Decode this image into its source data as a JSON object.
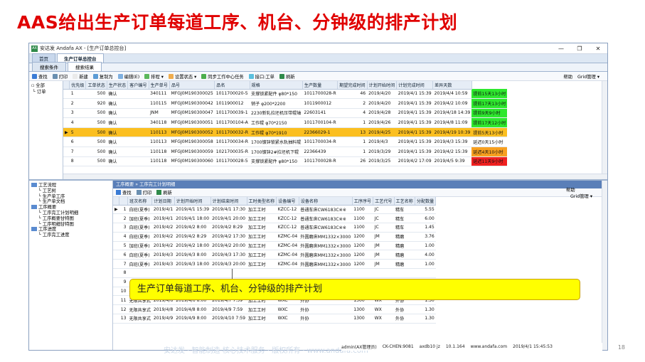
{
  "slide": {
    "title": "AAS给出生产订单每道工序、机台、分钟级的排产计划",
    "page_number": "18",
    "footer_text": "安达发 · 智能制造 核心技术服务 · 版权所有 · www.andafa.com",
    "callout": "生产订单每道工序、机台、分钟级的排产计划"
  },
  "window": {
    "title": "安达发 Andafa AX - [生产订单总控台]",
    "doc_tabs": [
      "首页",
      "生产订单总控台"
    ],
    "sub_tabs": [
      "搜索条件",
      "搜索结果"
    ]
  },
  "toolbar": {
    "items": [
      "查找",
      "打印",
      "新建",
      "复制为",
      "编辑(E)",
      "排程 ▾",
      "设置状态 ▾",
      "同步工作中心任务",
      "接口:工单",
      "刷新"
    ],
    "help": "帮助",
    "grid_mgmt": "Grid管理 ▾"
  },
  "left_tree": [
    "全部",
    "订单"
  ],
  "orders": {
    "columns": [
      "",
      "优先级",
      "工单状态",
      "生产状态",
      "客户编号",
      "生产单号",
      "品号",
      "品名",
      "规格",
      "生产数量",
      "期望完成时间",
      "计划开始时间",
      "计划完成时间",
      "差异天数"
    ],
    "rows": [
      {
        "idx": "1",
        "pri": "500",
        "status": "确认",
        "pstatus": "",
        "cust": "340111",
        "order": "MFGJ0M190300025",
        "item": "1011700020-5",
        "name": "支撑锁紧配件 φ80*150",
        "spec": "1011700028-R",
        "qty": "46",
        "due": "2019/4/20",
        "start": "2019/4/1 15:39",
        "finish": "2019/4/4 10:59",
        "diff": "提前15天13小时",
        "dclass": "st-g"
      },
      {
        "idx": "2",
        "pri": "920",
        "status": "确认",
        "pstatus": "",
        "cust": "110115",
        "order": "MFGJ0M190300042",
        "item": "1011900012",
        "name": "销子 φ200*2200",
        "spec": "1011900012",
        "qty": "2",
        "due": "2019/4/20",
        "start": "2019/4/1 15:39",
        "finish": "2019/4/2 10:09",
        "diff": "提前17天13小时",
        "dclass": "st-g"
      },
      {
        "idx": "3",
        "pri": "500",
        "status": "确认",
        "pstatus": "",
        "cust": "JNM",
        "order": "MFGJ0M190300047",
        "item": "1011700039-1",
        "name": "2230新轧拉坯机压带辊轴",
        "spec": "22603141",
        "qty": "4",
        "due": "2019/4/28",
        "start": "2019/4/1 15:39",
        "finish": "2019/4/18 14:39",
        "diff": "提前9天9小时",
        "dclass": "st-g"
      },
      {
        "idx": "4",
        "pri": "500",
        "status": "确认",
        "pstatus": "",
        "cust": "340118",
        "order": "MFGJ0M190300051",
        "item": "1011700104-A",
        "name": "工作辊 φ70*2150",
        "spec": "1011700104-R",
        "qty": "1",
        "due": "2019/4/26",
        "start": "2019/4/1 15:39",
        "finish": "2019/4/8 11:09",
        "diff": "提前17天12小时",
        "dclass": "st-g"
      },
      {
        "idx": "5",
        "pri": "500",
        "status": "确认",
        "pstatus": "",
        "cust": "110113",
        "order": "MFGJ0M190300052",
        "item": "1011700032-R",
        "name": "工作辊 φ70*1910",
        "spec": "22366029-1",
        "qty": "13",
        "due": "2019/4/25",
        "start": "2019/4/1 15:39",
        "finish": "2019/4/19 10:39",
        "diff": "提前5天13小时",
        "dclass": "st-y",
        "sel": true
      },
      {
        "idx": "6",
        "pri": "500",
        "status": "确认",
        "pstatus": "",
        "cust": "110113",
        "order": "MFGJ0M190300058",
        "item": "1011700034-R",
        "name": "1700镀锌锁紧水轨抽料辊",
        "spec": "1011700034-R",
        "qty": "1",
        "due": "2019/4/3",
        "start": "2019/4/1 15:39",
        "finish": "2019/4/3 15:39",
        "diff": "延迟0天15小时",
        "dclass": ""
      },
      {
        "idx": "7",
        "pri": "500",
        "status": "确认",
        "pstatus": "",
        "cust": "110118",
        "order": "MFGJ0M190300059",
        "item": "1021700035-R",
        "name": "1700镀锌2#拉坯机下辊",
        "spec": "22366439",
        "qty": "1",
        "due": "2019/3/29",
        "start": "2019/4/1 15:39",
        "finish": "2019/4/2 15:39",
        "diff": "延迟4天10小时",
        "dclass": "st-o"
      },
      {
        "idx": "8",
        "pri": "500",
        "status": "确认",
        "pstatus": "",
        "cust": "110118",
        "order": "MFGJ0M190300060",
        "item": "1011700028-5",
        "name": "支撑锁紧配件 φ80*150",
        "spec": "1011700028-R",
        "qty": "26",
        "due": "2019/3/25",
        "start": "2019/4/2 17:09",
        "finish": "2019/4/5 9:39",
        "diff": "延迟11天9小时",
        "dclass": "st-r"
      }
    ]
  },
  "lower": {
    "header": "工序概要 » 工序完工计划明细",
    "toolbar": [
      "查找",
      "打印",
      "刷新"
    ],
    "help": "帮助",
    "grid_mgmt": "Grid管理 ▾",
    "tree": [
      "工艺流程",
      "工艺树",
      "生产单工序",
      "生产单文档",
      "工序概要",
      "工序完工计划明细",
      "工序概要甘特图",
      "工序明细甘特图",
      "工序进度",
      "工序完工进度"
    ],
    "columns": [
      "",
      "",
      "班次名称",
      "计划日期",
      "计划开始时间",
      "计划结束时间",
      "工时类型名称",
      "设备编号",
      "设备名称",
      "工序序号",
      "工艺代号",
      "工艺名称",
      "分配数量"
    ],
    "rows": [
      [
        "▶",
        "1",
        "白班(夏季)",
        "2019/4/1",
        "2019/4/1 15:39",
        "2019/4/1 17:30",
        "加工工时",
        "KZCC-12",
        "普通车床CW6183C※※",
        "1100",
        "JC",
        "精车",
        "5.55"
      ],
      [
        "",
        "2",
        "加班(夏季)",
        "2019/4/1",
        "2019/4/1 18:00",
        "2019/4/1 20:00",
        "加工工时",
        "KZCC-12",
        "普通车床CW6183C※※",
        "1100",
        "JC",
        "精车",
        "6.00"
      ],
      [
        "",
        "3",
        "白班(夏季)",
        "2019/4/2",
        "2019/4/2 8:00",
        "2019/4/2 8:29",
        "加工工时",
        "KZCC-12",
        "普通车床CW6183C※※",
        "1100",
        "JC",
        "精车",
        "1.45"
      ],
      [
        "",
        "4",
        "白班(夏季)",
        "2019/4/2",
        "2019/4/2 8:29",
        "2019/4/2 17:30",
        "加工工时",
        "KZMC-04",
        "外圆磨床MM1332×3000",
        "1200",
        "JM",
        "精磨",
        "3.76"
      ],
      [
        "",
        "5",
        "加班(夏季)",
        "2019/4/2",
        "2019/4/2 18:00",
        "2019/4/2 20:00",
        "加工工时",
        "KZMC-04",
        "外圆磨床MM1332×3000",
        "1200",
        "JM",
        "精磨",
        "1.00"
      ],
      [
        "",
        "6",
        "白班(夏季)",
        "2019/4/3",
        "2019/4/3 8:00",
        "2019/4/3 17:30",
        "加工工时",
        "KZMC-04",
        "外圆磨床MM1332×3000",
        "1200",
        "JM",
        "精磨",
        "4.00"
      ],
      [
        "",
        "7",
        "白班(夏季)",
        "2019/4/3",
        "2019/4/3 18:00",
        "2019/4/3 20:00",
        "加工工时",
        "KZMC-04",
        "外圆磨床MM1332×3000",
        "1200",
        "JM",
        "精磨",
        "1.00"
      ],
      [
        "",
        "8",
        "",
        "",
        "",
        "",
        "",
        "",
        "",
        "",
        "",
        "",
        ""
      ],
      [
        "",
        "9",
        "",
        "",
        "",
        "",
        "",
        "",
        "",
        "",
        "",
        "",
        ""
      ],
      [
        "",
        "10",
        "无限共享式",
        "2019/4/5",
        "2019/4/5 8:00",
        "2019/4/6 7:59",
        "加工工时",
        "WXC",
        "外协",
        "1300",
        "WX",
        "外协",
        "1.30"
      ],
      [
        "",
        "11",
        "无限共享式",
        "2019/4/6",
        "2019/4/6 8:00",
        "2019/4/7 7:59",
        "加工工时",
        "WXC",
        "外协",
        "1300",
        "WX",
        "外协",
        "1.30"
      ],
      [
        "",
        "12",
        "无限共享式",
        "2019/4/8",
        "2019/4/8 8:00",
        "2019/4/9 7:59",
        "加工工时",
        "WXC",
        "外协",
        "1300",
        "WX",
        "外协",
        "1.30"
      ],
      [
        "",
        "13",
        "无限共享式",
        "2019/4/9",
        "2019/4/9 8:00",
        "2019/4/10 7:59",
        "加工工时",
        "WXC",
        "外协",
        "1300",
        "WX",
        "外协",
        "1.30"
      ]
    ]
  },
  "statusbar": [
    "admin(AX管理员)",
    "CK-CHEN:9081",
    "axdb10 jz",
    "10.1.164",
    "www.andafa.com",
    "2019/4/1 15:45:53"
  ],
  "colors": {
    "title_red": "#e00000",
    "selected_row": "#fbbf20",
    "ahead": "#2ee82e",
    "late": "#f8a020",
    "very_late": "#f02020",
    "callout": "#ffff00"
  }
}
